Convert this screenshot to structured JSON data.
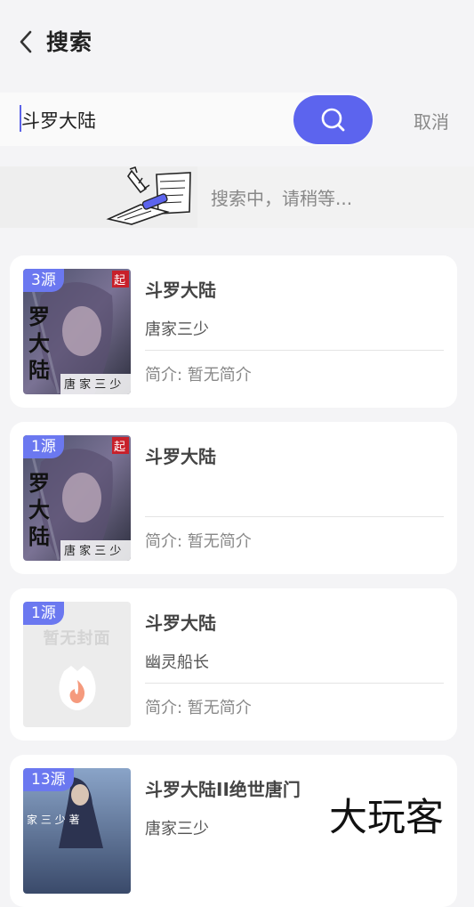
{
  "header": {
    "title": "搜索"
  },
  "search": {
    "query": "斗罗大陆",
    "cancel_label": "取消"
  },
  "loading": {
    "text": "搜索中，请稍等..."
  },
  "results": [
    {
      "badge": "3源",
      "title": "斗罗大陆",
      "author": "唐家三少",
      "intro": "简介: 暂无简介"
    },
    {
      "badge": "1源",
      "title": "斗罗大陆",
      "author": "",
      "intro": "简介: 暂无简介"
    },
    {
      "badge": "1源",
      "title": "斗罗大陆",
      "author": "幽灵船长",
      "intro": "简介: 暂无简介",
      "cover_placeholder": "暂无封面"
    },
    {
      "badge": "13源",
      "title": "斗罗大陆II绝世唐门",
      "author": "唐家三少",
      "intro": ""
    }
  ],
  "watermark": "大玩客",
  "colors": {
    "accent": "#5c64ee",
    "badge": "#6b78f0",
    "background": "#f4f4f6"
  }
}
